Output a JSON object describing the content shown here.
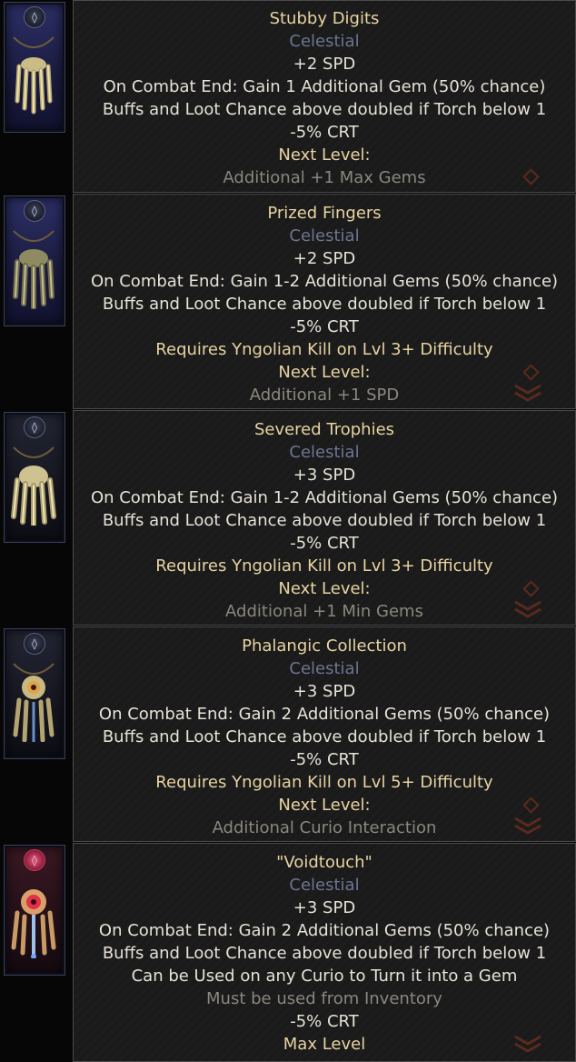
{
  "theme": {
    "gem_tier": "Celestial"
  },
  "curios": [
    {
      "name": "Stubby Digits",
      "tier": "Celestial",
      "icon": "stubby-digits-claw-icon",
      "lines": [
        {
          "text": "+2 SPD",
          "kind": "stat"
        },
        {
          "text": "On Combat End: Gain 1 Additional Gem (50% chance)",
          "kind": "stat"
        },
        {
          "text": "Buffs and Loot Chance above doubled if Torch below 1",
          "kind": "stat"
        },
        {
          "text": "-5% CRT",
          "kind": "stat"
        },
        {
          "text": "Next Level:",
          "kind": "next"
        },
        {
          "text": "Additional +1 Max Gems",
          "kind": "nextv"
        }
      ]
    },
    {
      "name": "Prized Fingers",
      "tier": "Celestial",
      "icon": "prized-fingers-claw-icon",
      "lines": [
        {
          "text": "+2 SPD",
          "kind": "stat"
        },
        {
          "text": "On Combat End: Gain 1-2 Additional Gems (50% chance)",
          "kind": "stat"
        },
        {
          "text": "Buffs and Loot Chance above doubled if Torch below 1",
          "kind": "stat"
        },
        {
          "text": "-5% CRT",
          "kind": "stat"
        },
        {
          "text": "Requires Yngolian Kill on Lvl 3+ Difficulty",
          "kind": "req"
        },
        {
          "text": "Next Level:",
          "kind": "next"
        },
        {
          "text": "Additional +1 SPD",
          "kind": "nextv"
        }
      ]
    },
    {
      "name": "Severed Trophies",
      "tier": "Celestial",
      "icon": "severed-trophies-claw-icon",
      "lines": [
        {
          "text": "+3 SPD",
          "kind": "stat"
        },
        {
          "text": "On Combat End: Gain 1-2 Additional Gems (50% chance)",
          "kind": "stat"
        },
        {
          "text": "Buffs and Loot Chance above doubled if Torch below 1",
          "kind": "stat"
        },
        {
          "text": "-5% CRT",
          "kind": "stat"
        },
        {
          "text": "Requires Yngolian Kill on Lvl 3+ Difficulty",
          "kind": "req"
        },
        {
          "text": "Next Level:",
          "kind": "next"
        },
        {
          "text": "Additional +1 Min Gems",
          "kind": "nextv"
        }
      ]
    },
    {
      "name": "Phalangic Collection",
      "tier": "Celestial",
      "icon": "phalangic-collection-eye-icon",
      "lines": [
        {
          "text": "+3 SPD",
          "kind": "stat"
        },
        {
          "text": "On Combat End: Gain 2 Additional Gems (50% chance)",
          "kind": "stat"
        },
        {
          "text": "Buffs and Loot Chance above doubled if Torch below 1",
          "kind": "stat"
        },
        {
          "text": "-5% CRT",
          "kind": "stat"
        },
        {
          "text": "Requires Yngolian Kill on Lvl 5+ Difficulty",
          "kind": "req"
        },
        {
          "text": "Next Level:",
          "kind": "next"
        },
        {
          "text": "Additional Curio Interaction",
          "kind": "nextv"
        }
      ]
    },
    {
      "name": "\"Voidtouch\"",
      "tier": "Celestial",
      "icon": "voidtouch-eye-icon",
      "lines": [
        {
          "text": "+3 SPD",
          "kind": "stat"
        },
        {
          "text": "On Combat End: Gain 2 Additional Gems (50% chance)",
          "kind": "stat"
        },
        {
          "text": "Buffs and Loot Chance above doubled if Torch below 1",
          "kind": "stat"
        },
        {
          "text": "Can be Used on any Curio to Turn it into a Gem",
          "kind": "stat"
        },
        {
          "text": "Must be used from Inventory",
          "kind": "muted"
        },
        {
          "text": "-5% CRT",
          "kind": "stat"
        },
        {
          "text": "Max Level",
          "kind": "max"
        }
      ]
    }
  ]
}
